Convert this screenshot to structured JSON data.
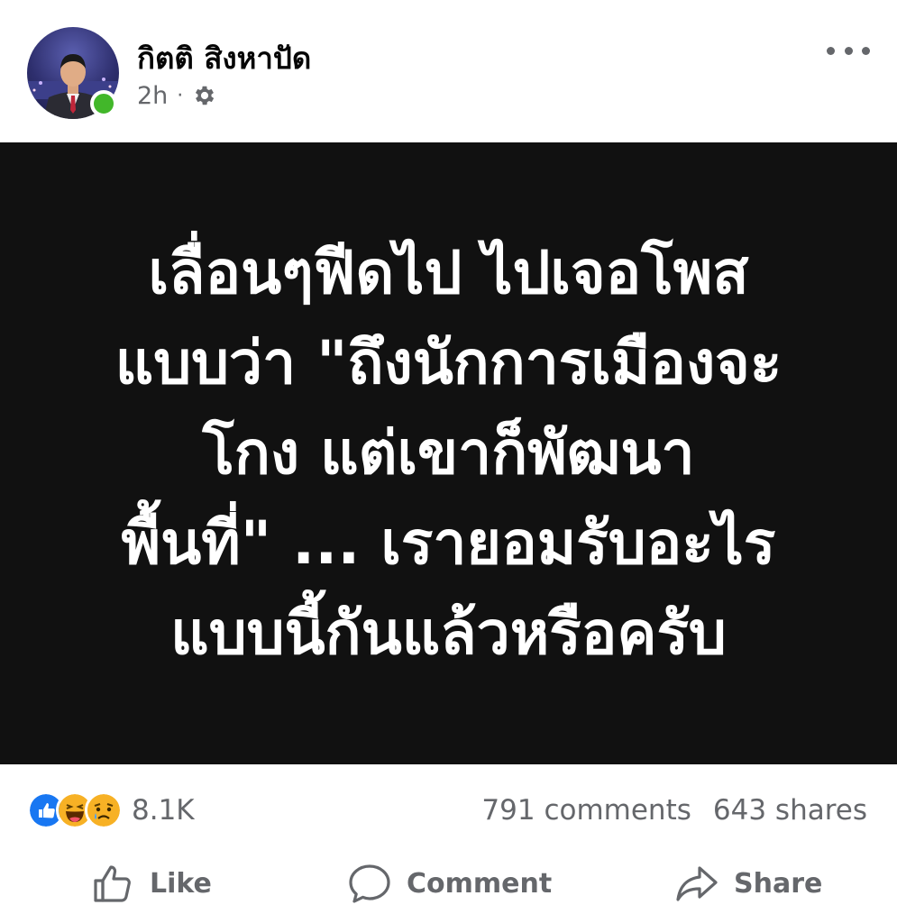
{
  "header": {
    "author_name": "กิตติ สิงหาปัด",
    "timestamp": "2h",
    "separator": "·",
    "privacy_icon": "gear-icon",
    "more_icon": "more-horizontal-icon",
    "online": true
  },
  "post": {
    "background_color": "#111111",
    "text_color": "#ffffff",
    "lines": [
      "เลื่อนๆฟีดไป ไปเจอโพส",
      "แบบว่า \"ถึงนักการเมืองจะ",
      "โกง แต่เขาก็พัฒนา",
      "พื้นที่\" ... เรายอมรับอะไร",
      "แบบนี้กันแล้วหรือครับ"
    ]
  },
  "stats": {
    "reactions": [
      "like-reaction-icon",
      "haha-reaction-icon",
      "sad-reaction-icon"
    ],
    "reaction_count": "8.1K",
    "comments": "791 comments",
    "shares": "643 shares"
  },
  "actions": {
    "like_label": "Like",
    "comment_label": "Comment",
    "share_label": "Share"
  },
  "colors": {
    "like_blue": "#1877f2",
    "reaction_yellow": "#f7b125",
    "online_green": "#42b72a",
    "meta_gray": "#65676b"
  }
}
